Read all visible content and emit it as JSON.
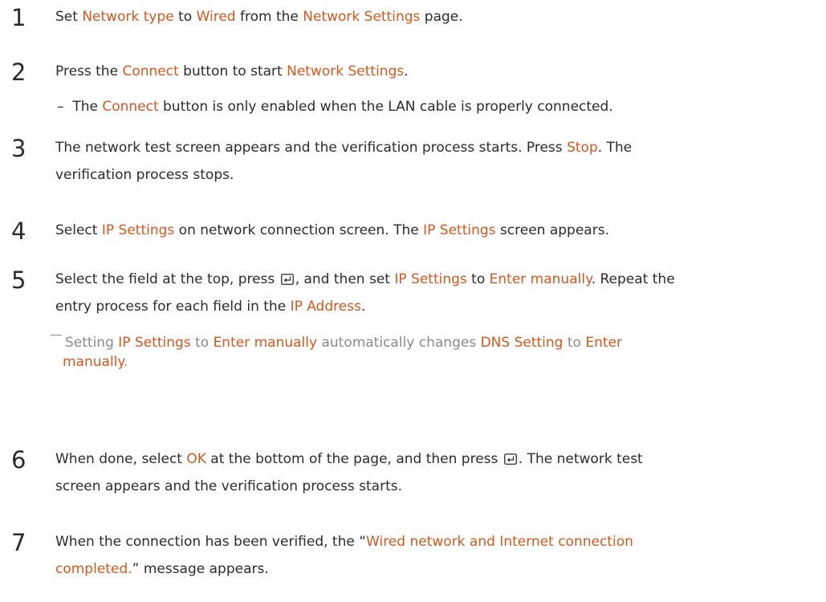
{
  "steps": [
    {
      "number": "1",
      "parts": [
        "Set ",
        "Network type",
        " to ",
        "Wired",
        " from the ",
        "Network Settings",
        " page."
      ]
    },
    {
      "number": "2",
      "parts": [
        "Press the ",
        "Connect",
        " button to start ",
        "Network Settings",
        "."
      ],
      "sub": {
        "dash": "–",
        "parts": [
          "The ",
          "Connect",
          " button is only enabled when the LAN cable is properly connected."
        ]
      }
    },
    {
      "number": "3",
      "line1": [
        "The network test screen appears and the verification process starts. Press ",
        "Stop",
        ". The"
      ],
      "line2": "verification process stops."
    },
    {
      "number": "4",
      "parts": [
        "Select ",
        "IP Settings",
        " on network connection screen. The ",
        "IP Settings",
        " screen appears."
      ]
    },
    {
      "number": "5",
      "line1": [
        "Select the field at the top, press ",
        ", and then set ",
        "IP Settings",
        " to ",
        "Enter manually",
        ". Repeat the"
      ],
      "line2": [
        "entry process for each field in the ",
        "IP Address",
        "."
      ],
      "note": {
        "line1": [
          "Setting ",
          "IP Settings",
          " to ",
          "Enter manually",
          " automatically changes ",
          "DNS Setting",
          " to ",
          "Enter"
        ],
        "line2": [
          "manually",
          "."
        ]
      }
    },
    {
      "number": "6",
      "line1": [
        "When done, select ",
        "OK",
        " at the bottom of the page, and then press ",
        ". The network test"
      ],
      "line2": "screen appears and the verification process starts."
    },
    {
      "number": "7",
      "line1": [
        "When the connection has been verified, the “",
        "Wired network and Internet connection"
      ],
      "line2": [
        "completed.",
        "” message appears."
      ]
    }
  ],
  "icons": {
    "enter": "enter-key-icon",
    "accent_color": "#d2581e"
  }
}
